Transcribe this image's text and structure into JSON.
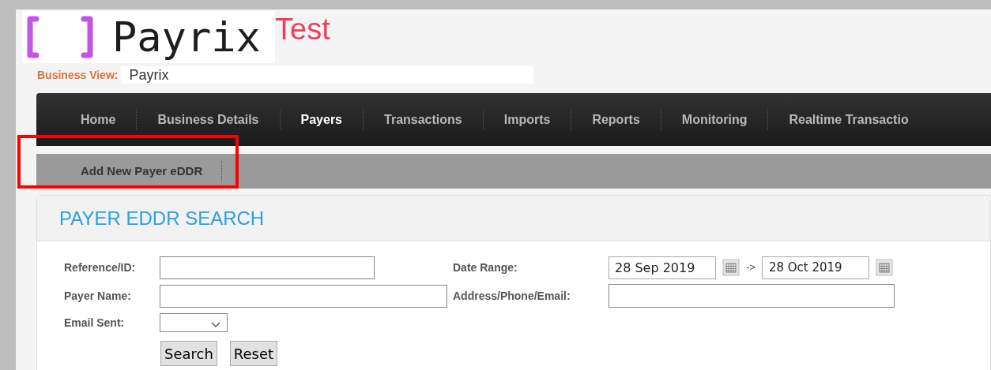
{
  "logo": {
    "wordmark": "Payrix",
    "badge": "Test"
  },
  "business_view": {
    "label": "Business View:",
    "value": "Payrix"
  },
  "nav": [
    {
      "label": "Home",
      "selected": false
    },
    {
      "label": "Business Details",
      "selected": false
    },
    {
      "label": "Payers",
      "selected": true
    },
    {
      "label": "Transactions",
      "selected": false
    },
    {
      "label": "Imports",
      "selected": false
    },
    {
      "label": "Reports",
      "selected": false
    },
    {
      "label": "Monitoring",
      "selected": false
    },
    {
      "label": "Realtime Transactio",
      "selected": false
    }
  ],
  "subnav": [
    {
      "label": "Add New Payer eDDR",
      "highlighted": true
    }
  ],
  "panel": {
    "title": "PAYER EDDR SEARCH",
    "reference_label": "Reference/ID:",
    "payer_name_label": "Payer Name:",
    "email_sent_label": "Email Sent:",
    "date_range_label": "Date Range:",
    "date_from": "28 Sep 2019",
    "date_separator": "->",
    "date_to": "28 Oct 2019",
    "address_label": "Address/Phone/Email:",
    "buttons": [
      "Search",
      "Reset"
    ]
  }
}
